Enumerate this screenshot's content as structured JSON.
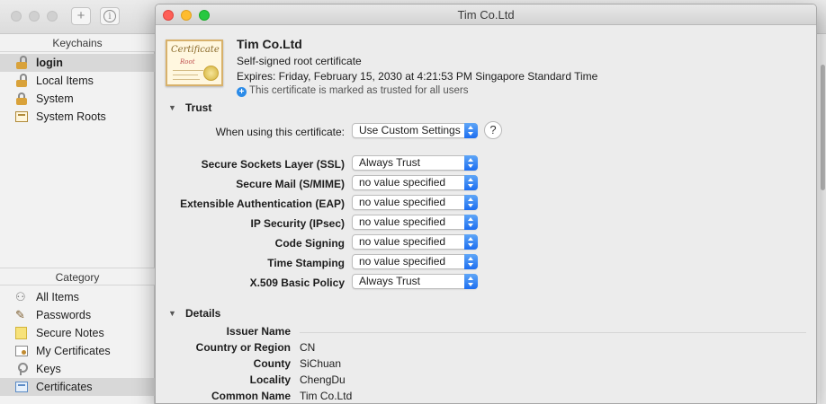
{
  "toolbar": {
    "add_label": "+",
    "info_label": "i"
  },
  "sidebar": {
    "keychains_header": "Keychains",
    "keychains": [
      {
        "label": "login",
        "icon": "open-lock-icon",
        "selected": true
      },
      {
        "label": "Local Items",
        "icon": "lock-icon"
      },
      {
        "label": "System",
        "icon": "lock-icon"
      },
      {
        "label": "System Roots",
        "icon": "certificate-icon"
      }
    ],
    "category_header": "Category",
    "categories": [
      {
        "label": "All Items",
        "icon": "people-icon"
      },
      {
        "label": "Passwords",
        "icon": "pen-icon"
      },
      {
        "label": "Secure Notes",
        "icon": "note-icon"
      },
      {
        "label": "My Certificates",
        "icon": "my-certificate-icon"
      },
      {
        "label": "Keys",
        "icon": "key-icon"
      },
      {
        "label": "Certificates",
        "icon": "certificate-icon",
        "selected": true
      }
    ]
  },
  "window": {
    "title": "Tim Co.Ltd"
  },
  "certificate": {
    "thumb_title": "Certificate",
    "thumb_subtitle": "Root",
    "name": "Tim Co.Ltd",
    "type": "Self-signed root certificate",
    "expires": "Expires: Friday, February 15, 2030 at 4:21:53 PM Singapore Standard Time",
    "trust_status": "This certificate is marked as trusted for all users"
  },
  "trust": {
    "section_label": "Trust",
    "using_label": "When using this certificate:",
    "using_value": "Use Custom Settings",
    "help_label": "?",
    "rows": [
      {
        "label": "Secure Sockets Layer (SSL)",
        "value": "Always Trust"
      },
      {
        "label": "Secure Mail (S/MIME)",
        "value": "no value specified"
      },
      {
        "label": "Extensible Authentication (EAP)",
        "value": "no value specified"
      },
      {
        "label": "IP Security (IPsec)",
        "value": "no value specified"
      },
      {
        "label": "Code Signing",
        "value": "no value specified"
      },
      {
        "label": "Time Stamping",
        "value": "no value specified"
      },
      {
        "label": "X.509 Basic Policy",
        "value": "Always Trust"
      }
    ]
  },
  "details": {
    "section_label": "Details",
    "issuer_header": "Issuer Name",
    "rows": [
      {
        "label": "Country or Region",
        "value": "CN"
      },
      {
        "label": "County",
        "value": "SiChuan"
      },
      {
        "label": "Locality",
        "value": "ChengDu"
      },
      {
        "label": "Common Name",
        "value": "Tim Co.Ltd"
      }
    ]
  }
}
